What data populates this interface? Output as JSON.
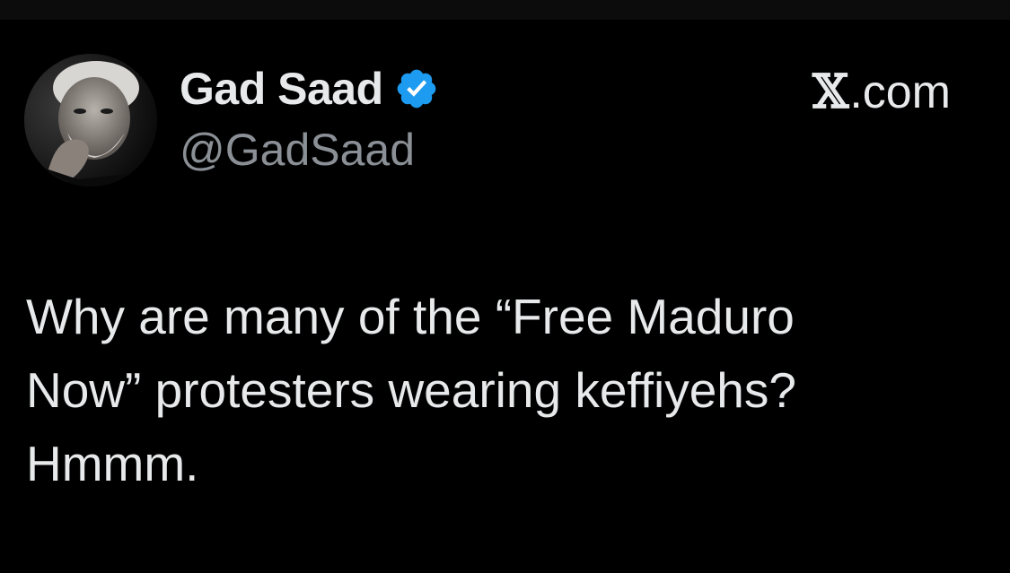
{
  "author": {
    "display_name": "Gad Saad",
    "handle": "@GadSaad",
    "verified": true,
    "avatar_icon": "profile-photo"
  },
  "source": {
    "logo": "𝕏",
    "label": ".com"
  },
  "tweet": {
    "text": "Why are many of the “Free Maduro\nNow” protesters wearing keffiyehs?\nHmmm."
  },
  "colors": {
    "background": "#000000",
    "text": "#e7e9ea",
    "handle": "#8b9096",
    "verified_badge": "#1d9bf0"
  }
}
